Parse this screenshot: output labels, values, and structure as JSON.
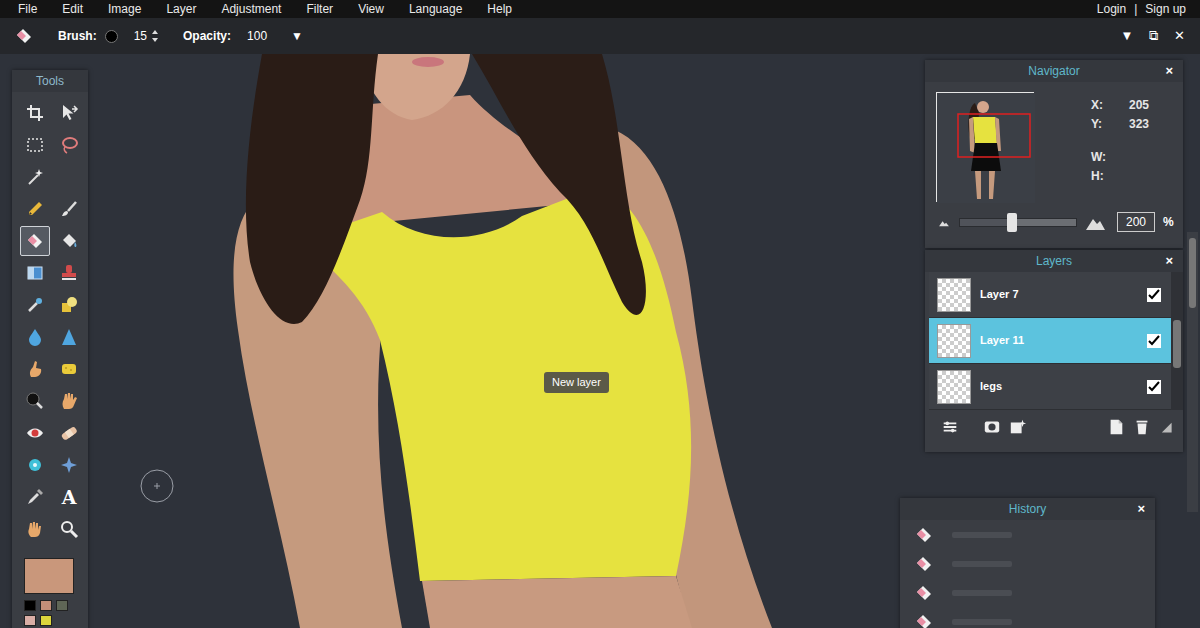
{
  "menu": {
    "items": [
      "File",
      "Edit",
      "Image",
      "Layer",
      "Adjustment",
      "Filter",
      "View",
      "Language",
      "Help"
    ],
    "account": [
      "Login",
      "|",
      "Sign up"
    ]
  },
  "toolbar": {
    "brush_label": "Brush:",
    "brush_size": "15",
    "opacity_label": "Opacity:",
    "opacity": "100",
    "opacity_arrow": "▼"
  },
  "window_controls": [
    "▼",
    "⧉",
    "✕"
  ],
  "tools": {
    "title": "Tools",
    "rows": [
      [
        {
          "kind": "crop",
          "selected": false
        },
        {
          "kind": "move",
          "selected": false
        }
      ],
      [
        {
          "kind": "marquee",
          "selected": false
        },
        {
          "kind": "lasso",
          "selected": false
        }
      ],
      [
        {
          "kind": "wand",
          "selected": false
        }
      ],
      [
        {
          "kind": "pencil",
          "selected": false
        },
        {
          "kind": "brush",
          "selected": false
        }
      ],
      [
        {
          "kind": "eraser",
          "selected": true
        },
        {
          "kind": "bucket",
          "selected": false
        }
      ],
      [
        {
          "kind": "gradient",
          "selected": false
        },
        {
          "kind": "stamp",
          "selected": false
        }
      ],
      [
        {
          "kind": "replace",
          "selected": false
        },
        {
          "kind": "shapes",
          "selected": false
        }
      ],
      [
        {
          "kind": "blur",
          "selected": false
        },
        {
          "kind": "sharpen",
          "selected": false
        }
      ],
      [
        {
          "kind": "smudge",
          "selected": false
        },
        {
          "kind": "sponge",
          "selected": false
        }
      ],
      [
        {
          "kind": "dodge",
          "selected": false
        },
        {
          "kind": "burn",
          "selected": false
        }
      ],
      [
        {
          "kind": "redeye",
          "selected": false
        },
        {
          "kind": "heal",
          "selected": false
        }
      ],
      [
        {
          "kind": "bloat",
          "selected": false
        },
        {
          "kind": "pinch",
          "selected": false
        }
      ],
      [
        {
          "kind": "picker",
          "selected": false
        },
        {
          "kind": "text",
          "glyph": "A",
          "selected": false
        }
      ],
      [
        {
          "kind": "hand",
          "selected": false
        },
        {
          "kind": "zoom",
          "selected": false
        }
      ]
    ]
  },
  "colors": {
    "primary": "#c9977b",
    "swatches": [
      {
        "color": "#000000"
      },
      {
        "color": "#c48f78"
      },
      {
        "color": "#5f6656"
      },
      {
        "color": "#d9aea6"
      },
      {
        "color": "#dcd53c"
      }
    ]
  },
  "canvas": {
    "tooltip": "New layer"
  },
  "navigator": {
    "title": "Navigator",
    "close": "×",
    "x_label": "X:",
    "x": "205",
    "y_label": "Y:",
    "y": "323",
    "w_label": "W:",
    "h_label": "H:",
    "zoom": "200",
    "zoom_unit": "%",
    "zoom_level": 0.45
  },
  "layers": {
    "title": "Layers",
    "close": "×",
    "items": [
      {
        "name": "Layer 7",
        "selected": false,
        "visible": true
      },
      {
        "name": "Layer 11",
        "selected": true,
        "visible": true
      },
      {
        "name": "legs",
        "selected": false,
        "visible": true
      }
    ]
  },
  "history": {
    "title": "History",
    "close": "×",
    "items": [
      {
        "selected": false
      },
      {
        "selected": false
      },
      {
        "selected": false
      },
      {
        "selected": false
      }
    ]
  }
}
